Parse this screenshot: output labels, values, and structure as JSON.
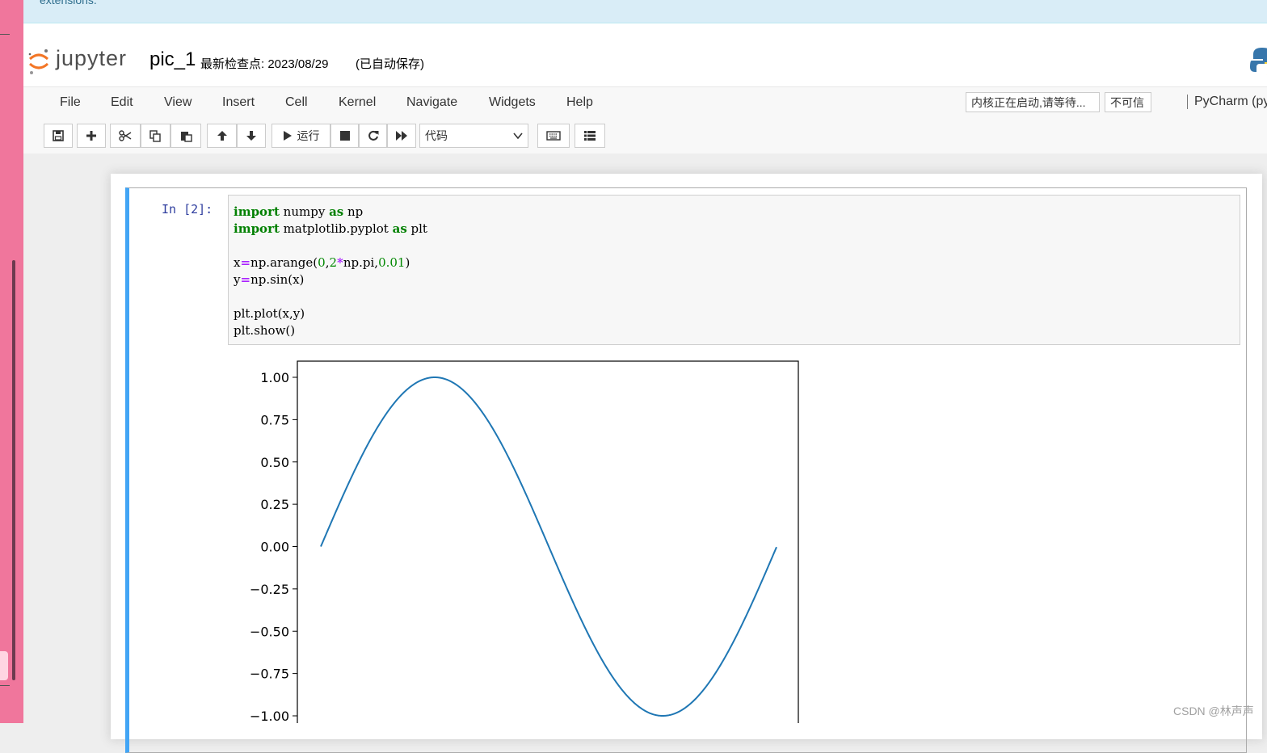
{
  "notice": {
    "text": "extensions."
  },
  "header": {
    "logo_text": "jupyter",
    "notebook_name": "pic_1",
    "checkpoint": "最新检查点: 2023/08/29",
    "autosave": "(已自动保存)"
  },
  "menu": {
    "items": [
      "File",
      "Edit",
      "View",
      "Insert",
      "Cell",
      "Kernel",
      "Navigate",
      "Widgets",
      "Help"
    ],
    "kernel_status": "内核正在启动,请等待...",
    "trust_status": "不可信",
    "kernel_name": "PyCharm (py"
  },
  "toolbar": {
    "run_label": "运行",
    "cell_type": "代码",
    "icons": [
      "save-icon",
      "plus-icon",
      "scissors-icon",
      "copy-icon",
      "paste-icon",
      "arrow-up-icon",
      "arrow-down-icon",
      "play-icon",
      "stop-icon",
      "restart-icon",
      "fast-forward-icon",
      "keyboard-icon",
      "list-icon"
    ]
  },
  "cell": {
    "prompt": "In  [2]:",
    "code_lines": [
      "import numpy as np",
      "import matplotlib.pyplot as plt",
      "",
      "x=np.arange(0,2*np.pi,0.01)",
      "y=np.sin(x)",
      "",
      "plt.plot(x,y)",
      "plt.show()"
    ]
  },
  "chart_data": {
    "type": "line",
    "function": "sin",
    "x_range": [
      0,
      6.28
    ],
    "x_step": 0.01,
    "ylim": [
      -1.0,
      1.0
    ],
    "yticks": [
      "1.00",
      "0.75",
      "0.50",
      "0.25",
      "0.00",
      "−0.25",
      "−0.50",
      "−0.75",
      "−1.00"
    ],
    "ytick_values": [
      1.0,
      0.75,
      0.5,
      0.25,
      0.0,
      -0.25,
      -0.5,
      -0.75,
      -1.0
    ],
    "series": [
      {
        "color": "#1f77b4"
      }
    ],
    "grid": false
  },
  "watermark": "CSDN @林声声"
}
